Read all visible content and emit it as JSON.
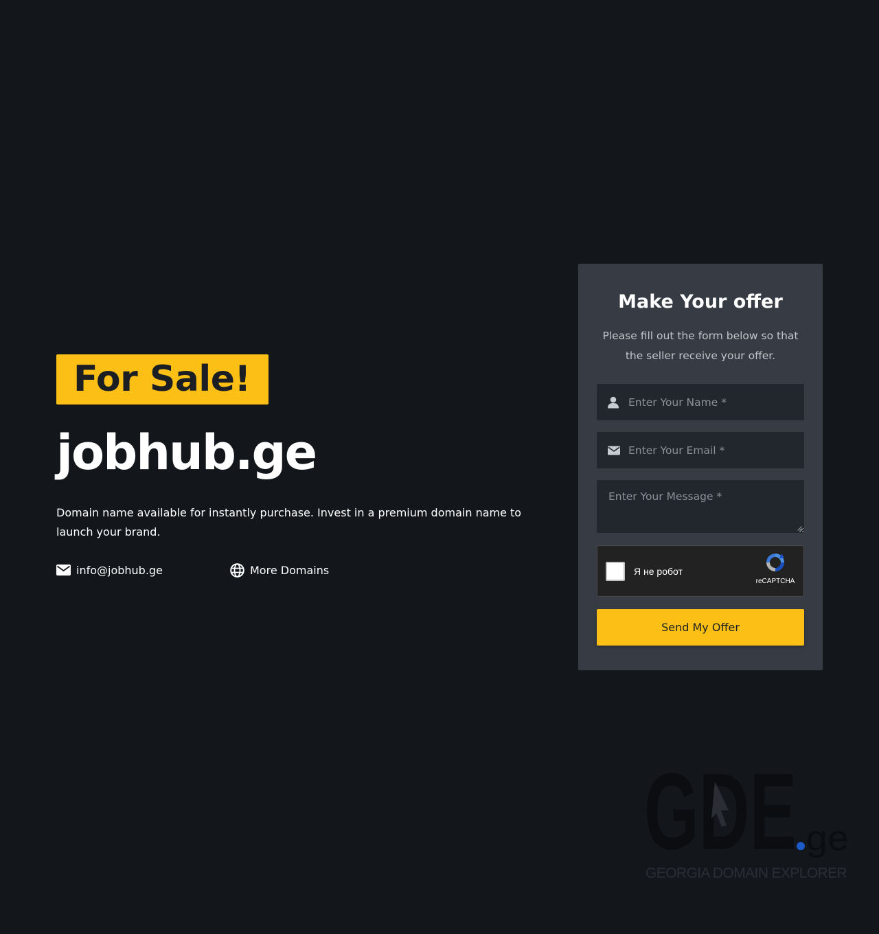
{
  "hero": {
    "badge": "For Sale!",
    "domain": "jobhub.ge",
    "description": "Domain name available for instantly purchase. Invest in a premium domain name to launch your brand.",
    "email_link": "info@jobhub.ge",
    "more_domains_link": "More Domains"
  },
  "offer_form": {
    "title": "Make Your offer",
    "subtitle": "Please fill out the form below so that the seller receive your offer.",
    "name_placeholder": "Enter Your Name *",
    "email_placeholder": "Enter Your Email *",
    "message_placeholder": "Enter Your Message *",
    "captcha_label": "Я не робот",
    "captcha_brand": "reCAPTCHA",
    "submit_label": "Send My Offer"
  },
  "logo": {
    "wordmark": "GDE",
    "tld": ".ge",
    "tagline": "GEORGIA DOMAIN EXPLORER"
  },
  "colors": {
    "background": "#13171c",
    "accent": "#fbbf15",
    "card": "#363b44",
    "field": "#22272e",
    "logo_dot": "#1a5bc7"
  },
  "icons": {
    "email": "envelope-icon",
    "globe": "globe-icon",
    "name_field": "user-icon",
    "email_field": "envelope-icon",
    "captcha": "recaptcha-icon"
  }
}
